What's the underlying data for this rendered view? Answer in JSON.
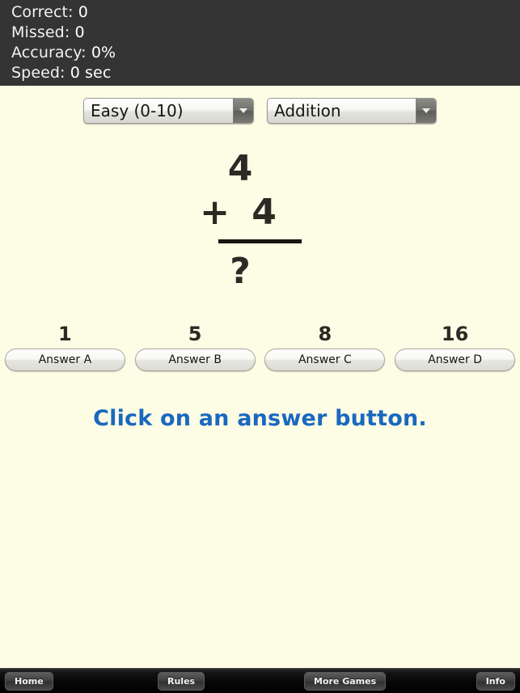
{
  "stats": {
    "lines": [
      {
        "label": "Correct:",
        "value": "0"
      },
      {
        "label": "Missed:",
        "value": "0"
      },
      {
        "label": "Accuracy:",
        "value": "0%"
      },
      {
        "label": "Speed:",
        "value": "0 sec"
      }
    ]
  },
  "controls": {
    "difficulty": {
      "selected": "Easy (0-10)",
      "arrow_icon": "chevron-down-icon"
    },
    "operation": {
      "selected": "Addition",
      "arrow_icon": "chevron-down-icon"
    }
  },
  "problem": {
    "operand_1": "4",
    "operator": "+",
    "operand_2": "4",
    "operator_operand_line": "+ 4",
    "result": "?"
  },
  "answers": [
    {
      "value": "1",
      "label": "Answer A"
    },
    {
      "value": "5",
      "label": "Answer B"
    },
    {
      "value": "8",
      "label": "Answer C"
    },
    {
      "value": "16",
      "label": "Answer D"
    }
  ],
  "message": "Click on an answer button.",
  "toolbar": {
    "home": "Home",
    "rules": "Rules",
    "more_games": "More Games",
    "info": "Info"
  },
  "colors": {
    "background": "#fdfce4",
    "header_background": "#343434",
    "message_blue": "#1a68c0",
    "problem_text": "#2b2a24",
    "toolbar_background": "#000000"
  }
}
